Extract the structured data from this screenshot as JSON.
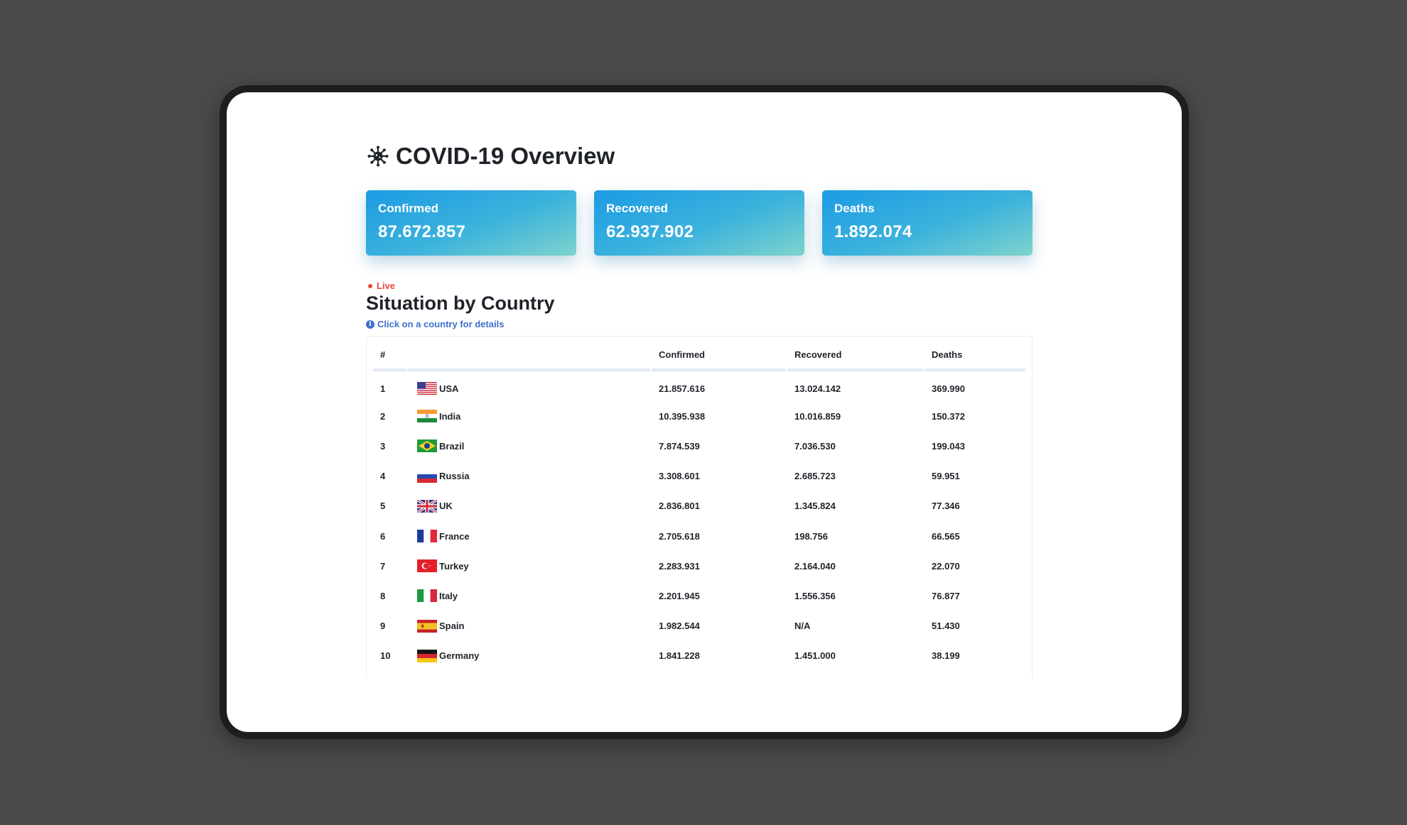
{
  "page": {
    "title": "COVID-19 Overview"
  },
  "summary": [
    {
      "label": "Confirmed",
      "value": "87.672.857"
    },
    {
      "label": "Recovered",
      "value": "62.937.902"
    },
    {
      "label": "Deaths",
      "value": "1.892.074"
    }
  ],
  "live_label": "Live",
  "section": {
    "title": "Situation by Country",
    "hint": "Click on a country for details"
  },
  "table": {
    "headers": {
      "rank": "#",
      "country": "",
      "confirmed": "Confirmed",
      "recovered": "Recovered",
      "deaths": "Deaths"
    },
    "rows": [
      {
        "rank": "1",
        "country": "USA",
        "flag": "usa-flag-icon",
        "confirmed": "21.857.616",
        "recovered": "13.024.142",
        "deaths": "369.990"
      },
      {
        "rank": "2",
        "country": "India",
        "flag": "india-flag-icon",
        "confirmed": "10.395.938",
        "recovered": "10.016.859",
        "deaths": "150.372"
      },
      {
        "rank": "3",
        "country": "Brazil",
        "flag": "brazil-flag-icon",
        "confirmed": "7.874.539",
        "recovered": "7.036.530",
        "deaths": "199.043"
      },
      {
        "rank": "4",
        "country": "Russia",
        "flag": "russia-flag-icon",
        "confirmed": "3.308.601",
        "recovered": "2.685.723",
        "deaths": "59.951"
      },
      {
        "rank": "5",
        "country": "UK",
        "flag": "uk-flag-icon",
        "confirmed": "2.836.801",
        "recovered": "1.345.824",
        "deaths": "77.346"
      },
      {
        "rank": "6",
        "country": "France",
        "flag": "france-flag-icon",
        "confirmed": "2.705.618",
        "recovered": "198.756",
        "deaths": "66.565"
      },
      {
        "rank": "7",
        "country": "Turkey",
        "flag": "turkey-flag-icon",
        "confirmed": "2.283.931",
        "recovered": "2.164.040",
        "deaths": "22.070"
      },
      {
        "rank": "8",
        "country": "Italy",
        "flag": "italy-flag-icon",
        "confirmed": "2.201.945",
        "recovered": "1.556.356",
        "deaths": "76.877"
      },
      {
        "rank": "9",
        "country": "Spain",
        "flag": "spain-flag-icon",
        "confirmed": "1.982.544",
        "recovered": "N/A",
        "deaths": "51.430"
      },
      {
        "rank": "10",
        "country": "Germany",
        "flag": "germany-flag-icon",
        "confirmed": "1.841.228",
        "recovered": "1.451.000",
        "deaths": "38.199"
      }
    ]
  },
  "colors": {
    "background": "#4a4a4a",
    "card_gradient_start": "#1c9be4",
    "card_gradient_end": "#7fd3cc",
    "live": "#e8453c",
    "hint": "#3d6fcf"
  }
}
